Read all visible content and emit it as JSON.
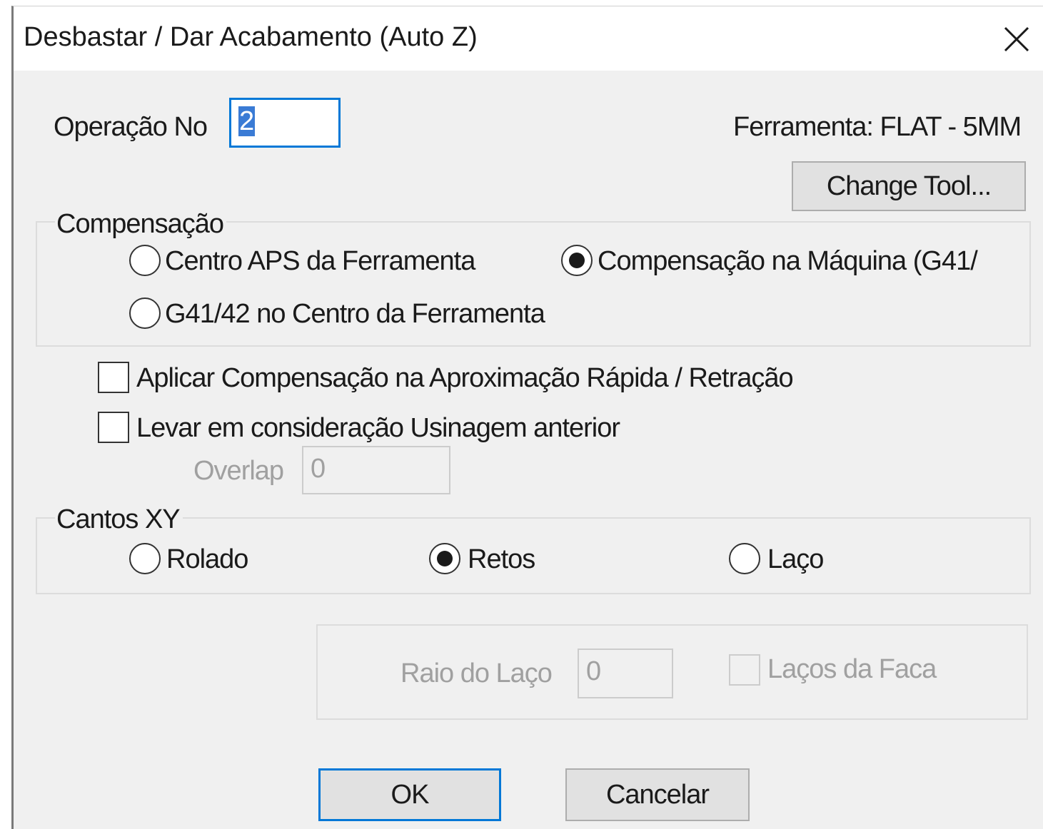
{
  "window": {
    "title": "Desbastar / Dar Acabamento (Auto Z)"
  },
  "operation": {
    "label": "Operação No",
    "value": "2"
  },
  "tool": {
    "label": "Ferramenta: FLAT - 5MM",
    "change_button": "Change Tool..."
  },
  "compensation": {
    "title": "Compensação",
    "options": [
      {
        "label": "Centro APS da Ferramenta",
        "selected": false
      },
      {
        "label": "Compensação na Máquina (G41/",
        "selected": true
      },
      {
        "label": "G41/42 no Centro da Ferramenta",
        "selected": false
      }
    ]
  },
  "checks": {
    "apply_comp": {
      "label": "Aplicar Compensação na Aproximação Rápida / Retração",
      "checked": false
    },
    "prev_machining": {
      "label": "Levar em consideração Usinagem anterior",
      "checked": false
    }
  },
  "overlap": {
    "label": "Overlap",
    "value": "0"
  },
  "corners": {
    "title": "Cantos XY",
    "options": [
      {
        "label": "Rolado",
        "selected": false
      },
      {
        "label": "Retos",
        "selected": true
      },
      {
        "label": "Laço",
        "selected": false
      }
    ]
  },
  "loop": {
    "radius_label": "Raio do Laço",
    "radius_value": "0",
    "face_loops_label": "Laços da Faca",
    "face_loops_checked": false
  },
  "buttons": {
    "ok": "OK",
    "cancel": "Cancelar"
  },
  "colors": {
    "focus_accent": "#0078d7",
    "window_bg": "#f0f0f0"
  }
}
